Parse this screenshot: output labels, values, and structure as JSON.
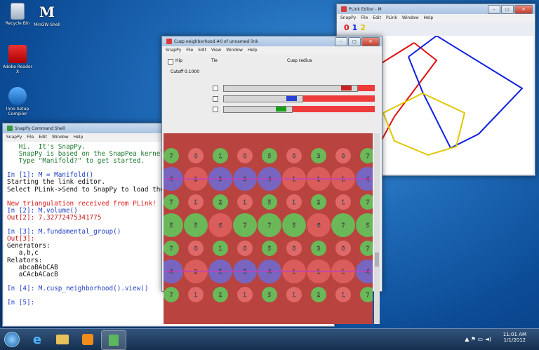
{
  "desktop": {
    "icons": [
      {
        "label": "Recycle Bin",
        "name": "recycle-bin-icon"
      },
      {
        "label": "MinGW Shell",
        "name": "mingw-shell-icon"
      },
      {
        "label": "Adobe Reader X",
        "name": "adobe-reader-icon"
      },
      {
        "label": "Inno Setup Compiler",
        "name": "inno-setup-icon"
      }
    ]
  },
  "shell": {
    "title": "SnapPy Command Shell",
    "menu": [
      "SnapPy",
      "File",
      "Edit",
      "Window",
      "Help"
    ],
    "lines": [
      {
        "t": "   Hi.  It's SnapPy.",
        "c": "c-banner"
      },
      {
        "t": "   SnapPy is based on the SnapPea kernel, written by Jeff Weeks.",
        "c": "c-banner"
      },
      {
        "t": "   Type \"Manifold?\" to get started.",
        "c": "c-banner"
      },
      {
        "t": "",
        "c": "c-txt"
      },
      {
        "t": "In [1]: M = Manifold()",
        "c": "c-in"
      },
      {
        "t": "Starting the link editor.",
        "c": "c-txt"
      },
      {
        "t": "Select PLink->Send to SnapPy to load the link complement.",
        "c": "c-txt"
      },
      {
        "t": "",
        "c": "c-txt"
      },
      {
        "t": "New triangulation received from PLink!",
        "c": "c-warn"
      },
      {
        "t": "In [2]: M.volume()",
        "c": "c-in"
      },
      {
        "t": "Out[2]: 7.32772475341775",
        "c": "c-out"
      },
      {
        "t": "",
        "c": "c-txt"
      },
      {
        "t": "In [3]: M.fundamental_group()",
        "c": "c-in"
      },
      {
        "t": "Out[3]:",
        "c": "c-out"
      },
      {
        "t": "Generators:",
        "c": "c-txt"
      },
      {
        "t": "   a,b,c",
        "c": "c-txt"
      },
      {
        "t": "Relators:",
        "c": "c-txt"
      },
      {
        "t": "   abcaBAbCAB",
        "c": "c-txt"
      },
      {
        "t": "   aCAcbACacB",
        "c": "c-txt"
      },
      {
        "t": "",
        "c": "c-txt"
      },
      {
        "t": "In [4]: M.cusp_neighborhood().view()",
        "c": "c-in"
      },
      {
        "t": "",
        "c": "c-txt"
      },
      {
        "t": "In [5]:",
        "c": "c-in"
      }
    ]
  },
  "cusp": {
    "title": "Cusp neighborhood #0 of unnamed link",
    "menu": [
      "SnapPy",
      "File",
      "Edit",
      "View",
      "Window",
      "Help"
    ],
    "hip_label": "Hip",
    "tie_label": "Tie",
    "cusp_radius_label": "Cusp radius",
    "cutoff_label": "Cutoff 0.1000",
    "sliders": [
      {
        "color": "#c82121",
        "fill": 0.88
      },
      {
        "color": "#2a3fd6",
        "fill": 0.52
      },
      {
        "color": "#18a018",
        "fill": 0.45
      }
    ],
    "grid_rows": [
      [
        "7",
        "0",
        "1",
        "0",
        "5",
        "0",
        "3",
        "0",
        "7"
      ],
      [
        "4",
        "2",
        "3",
        "3",
        "4",
        "1",
        "1",
        "1",
        "4"
      ],
      [
        "7",
        "1",
        "2",
        "1",
        "5",
        "1",
        "2",
        "1",
        "7"
      ],
      [
        "5",
        "5",
        "6",
        "7",
        "7",
        "5",
        "6",
        "7",
        "5"
      ],
      [
        "7",
        "0",
        "1",
        "0",
        "5",
        "0",
        "3",
        "0",
        "7"
      ],
      [
        "4",
        "2",
        "3",
        "3",
        "4",
        "1",
        "1",
        "1",
        "4"
      ],
      [
        "7",
        "1",
        "2",
        "1",
        "5",
        "1",
        "2",
        "1",
        "7"
      ]
    ]
  },
  "plink": {
    "title": "PLink Editor - M",
    "menu": [
      "SnapPy",
      "File",
      "Edit",
      "PLink",
      "Window",
      "Help"
    ],
    "components": [
      {
        "label": "0",
        "color": "#e01010"
      },
      {
        "label": "1",
        "color": "#1020e0"
      },
      {
        "label": "2",
        "color": "#e0c800"
      }
    ]
  },
  "taskbar": {
    "time": "11:01 AM",
    "date": "1/1/2012",
    "items": [
      "start-button",
      "ie-icon",
      "explorer-icon",
      "media-player-icon",
      "snappy-task-icon"
    ]
  }
}
